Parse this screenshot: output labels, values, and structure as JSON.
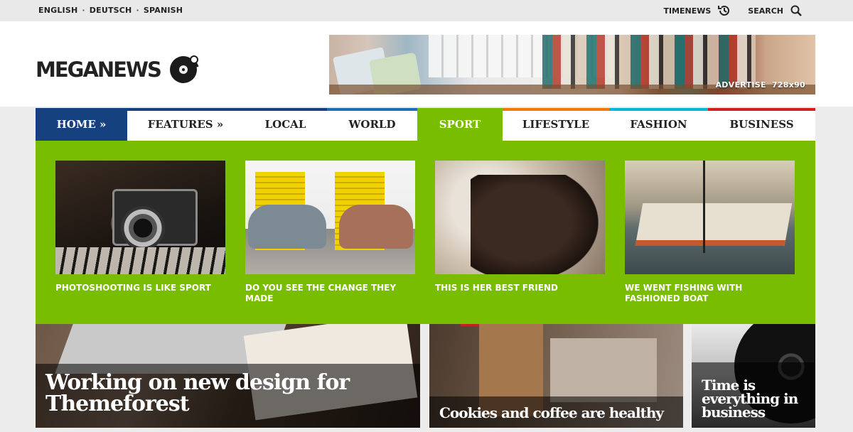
{
  "topbar": {
    "languages": [
      "ENGLISH",
      "DEUTSCH",
      "SPANISH"
    ],
    "separator": "·",
    "timenews_label": "TIMENEWS",
    "search_label": "SEARCH"
  },
  "header": {
    "logo_text": "MEGANEWS",
    "banner": {
      "label": "ADVERTISE",
      "size": "728x90"
    }
  },
  "nav": {
    "items": [
      {
        "label": "HOME »",
        "color": "#15427f"
      },
      {
        "label": "FEATURES »",
        "color": "#15427f"
      },
      {
        "label": "LOCAL",
        "color": "#15427f"
      },
      {
        "label": "WORLD",
        "color": "#1b6fb3"
      },
      {
        "label": "SPORT",
        "color": "#78bd00"
      },
      {
        "label": "LIFESTYLE",
        "color": "#f07b00"
      },
      {
        "label": "FASHION",
        "color": "#00b8d4"
      },
      {
        "label": "BUSINESS",
        "color": "#d41f1f"
      }
    ],
    "active_index": 4
  },
  "mega_menu": {
    "accent": "#78bd00",
    "cards": [
      {
        "title": "PHOTOSHOOTING IS LIKE SPORT"
      },
      {
        "title": "DO YOU SEE THE CHANGE THEY MADE"
      },
      {
        "title": "THIS IS HER BEST FRIEND"
      },
      {
        "title": "WE WENT FISHING WITH FASHIONED BOAT"
      }
    ]
  },
  "features": [
    {
      "title": "Working on new design for Themeforest"
    },
    {
      "title": "Cookies and coffee are healthy"
    },
    {
      "title": "Time is everything in business"
    }
  ]
}
